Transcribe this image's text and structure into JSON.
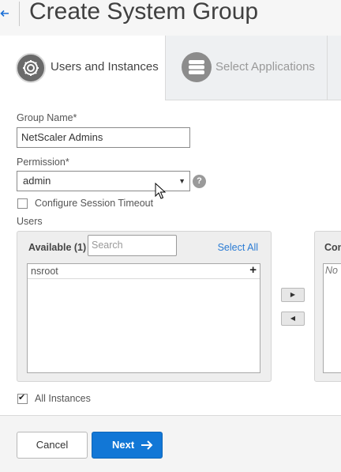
{
  "header": {
    "back_icon": "arrow-left-icon",
    "title": "Create System Group"
  },
  "tabs": [
    {
      "label": "Users and Instances",
      "icon": "gear-icon",
      "active": true
    },
    {
      "label": "Select Applications",
      "icon": "server-stack-icon",
      "active": false
    }
  ],
  "form": {
    "group_name_label": "Group Name*",
    "group_name_value": "NetScaler Admins",
    "permission_label": "Permission*",
    "permission_value": "admin",
    "help_icon_text": "?",
    "session_timeout_label": "Configure Session Timeout",
    "session_timeout_checked": false,
    "users_label": "Users"
  },
  "available_panel": {
    "title": "Available (1)",
    "search_placeholder": "Search",
    "select_all": "Select All",
    "items": [
      {
        "label": "nsroot",
        "action_icon": "plus-icon"
      }
    ]
  },
  "configured_panel": {
    "title": "Con",
    "empty_text": "No"
  },
  "transfer_buttons": {
    "add_icon": "triangle-right-icon",
    "remove_icon": "triangle-left-icon"
  },
  "all_instances": {
    "label": "All Instances",
    "checked": true
  },
  "footer": {
    "cancel_label": "Cancel",
    "next_label": "Next",
    "next_icon": "arrow-right-icon"
  },
  "colors": {
    "primary": "#1277d6",
    "link": "#2a7bd4"
  }
}
